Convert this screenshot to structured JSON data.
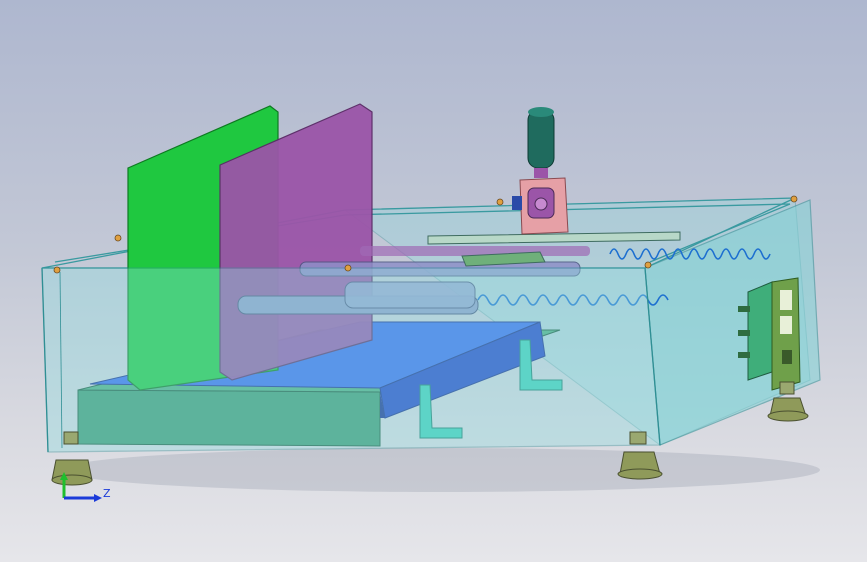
{
  "colors": {
    "background_top": "#aeb7cf",
    "background_bottom": "#e6e6ea",
    "enclosure": "#7fd3d6",
    "enclosure_edge": "#2f8f94",
    "green_plate": "#1fc840",
    "purple_plate": "#9b55a8",
    "blue_tray": "#2f56e8",
    "base_block": "#3e9a72",
    "spring": "#1d6fd0",
    "knob": "#1f6b5e",
    "bracket": "#e6a0a6",
    "foot": "#8f9a5a",
    "axis_x": "#1b3bd9",
    "axis_y": "#1fbf2e"
  },
  "icons": {
    "triad": "coordinate-triad-icon"
  },
  "triad": {
    "z_label": "Z"
  }
}
